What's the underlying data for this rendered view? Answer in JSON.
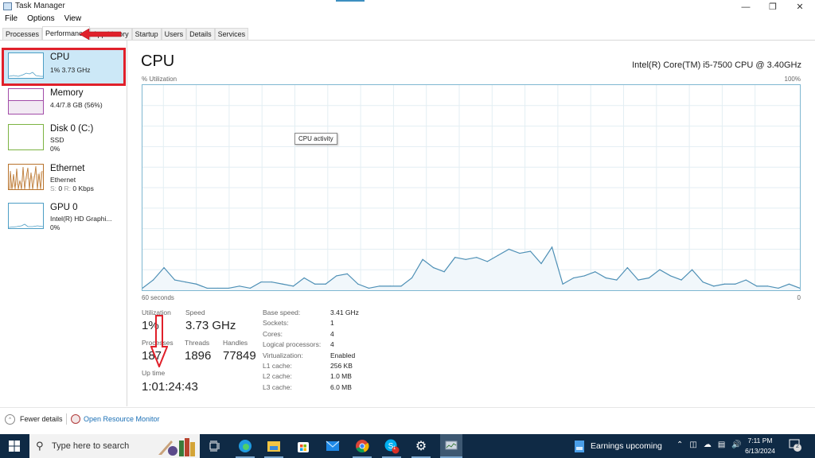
{
  "window": {
    "title": "Task Manager",
    "controls": [
      "minimize",
      "restore",
      "close"
    ]
  },
  "menu": [
    "File",
    "Options",
    "View"
  ],
  "tabs": [
    {
      "label": "Processes",
      "active": false
    },
    {
      "label": "Performance",
      "active": true
    },
    {
      "label": "App history",
      "active": false
    },
    {
      "label": "Startup",
      "active": false
    },
    {
      "label": "Users",
      "active": false
    },
    {
      "label": "Details",
      "active": false
    },
    {
      "label": "Services",
      "active": false
    }
  ],
  "sidebar": [
    {
      "name": "CPU",
      "line1": "1% 3.73 GHz",
      "line2": "",
      "color": "#4d9ec5",
      "selected": true
    },
    {
      "name": "Memory",
      "line1": "4.4/7.8 GB (56%)",
      "line2": "",
      "color": "#a24ca8",
      "selected": false
    },
    {
      "name": "Disk 0 (C:)",
      "line1": "SSD",
      "line2": "0%",
      "color": "#7cb342",
      "selected": false
    },
    {
      "name": "Ethernet",
      "line1": "Ethernet",
      "line2_send_label": "S:",
      "line2_send": "0",
      "line2_recv_label": "R:",
      "line2_recv": "0 Kbps",
      "color": "#b8732c",
      "selected": false
    },
    {
      "name": "GPU 0",
      "line1": "Intel(R) HD Graphi...",
      "line2": "0%",
      "color": "#4d9ec5",
      "selected": false
    }
  ],
  "main": {
    "title": "CPU",
    "model": "Intel(R) Core(TM) i5-7500 CPU @ 3.40GHz",
    "y_label": "% Utilization",
    "y_max_label": "100%",
    "x_left_label": "60 seconds",
    "x_right_label": "0",
    "tooltip": "CPU activity"
  },
  "chart_data": {
    "type": "area",
    "title": "CPU",
    "xlabel": "60 seconds",
    "ylabel": "% Utilization",
    "ylim": [
      0,
      100
    ],
    "xlim": [
      60,
      0
    ],
    "grid": true,
    "series": [
      {
        "name": "CPU activity",
        "color": "#4d8fb5",
        "values": [
          1,
          5,
          11,
          5,
          4,
          3,
          1,
          1,
          1,
          2,
          1,
          4,
          4,
          3,
          2,
          6,
          3,
          3,
          7,
          8,
          3,
          1,
          2,
          2,
          2,
          6,
          15,
          11,
          9,
          16,
          15,
          16,
          14,
          17,
          20,
          18,
          19,
          13,
          21,
          3,
          6,
          7,
          9,
          6,
          5,
          11,
          5,
          6,
          10,
          7,
          5,
          10,
          4,
          2,
          3,
          3,
          5,
          2,
          2,
          1,
          3,
          1
        ]
      }
    ]
  },
  "stats": {
    "utilization_label": "Utilization",
    "utilization": "1%",
    "speed_label": "Speed",
    "speed": "3.73 GHz",
    "processes_label": "Processes",
    "processes": "187",
    "threads_label": "Threads",
    "threads": "1896",
    "handles_label": "Handles",
    "handles": "77849",
    "uptime_label": "Up time",
    "uptime": "1:01:24:43"
  },
  "info": [
    {
      "key": "Base speed:",
      "value": "3.41 GHz"
    },
    {
      "key": "Sockets:",
      "value": "1"
    },
    {
      "key": "Cores:",
      "value": "4"
    },
    {
      "key": "Logical processors:",
      "value": "4"
    },
    {
      "key": "Virtualization:",
      "value": "Enabled"
    },
    {
      "key": "L1 cache:",
      "value": "256 KB"
    },
    {
      "key": "L2 cache:",
      "value": "1.0 MB"
    },
    {
      "key": "L3 cache:",
      "value": "6.0 MB"
    }
  ],
  "footer": {
    "fewer_details": "Fewer details",
    "open_resource_monitor": "Open Resource Monitor"
  },
  "taskbar": {
    "search_placeholder": "Type here to search",
    "apps": [
      "task-view",
      "edge",
      "file-explorer",
      "microsoft-store",
      "mail",
      "chrome",
      "skype",
      "settings",
      "task-manager"
    ],
    "skype_badge": "1",
    "news": "Earnings upcoming",
    "time": "7:11 PM",
    "date": "6/13/2024",
    "notifications": "2"
  }
}
